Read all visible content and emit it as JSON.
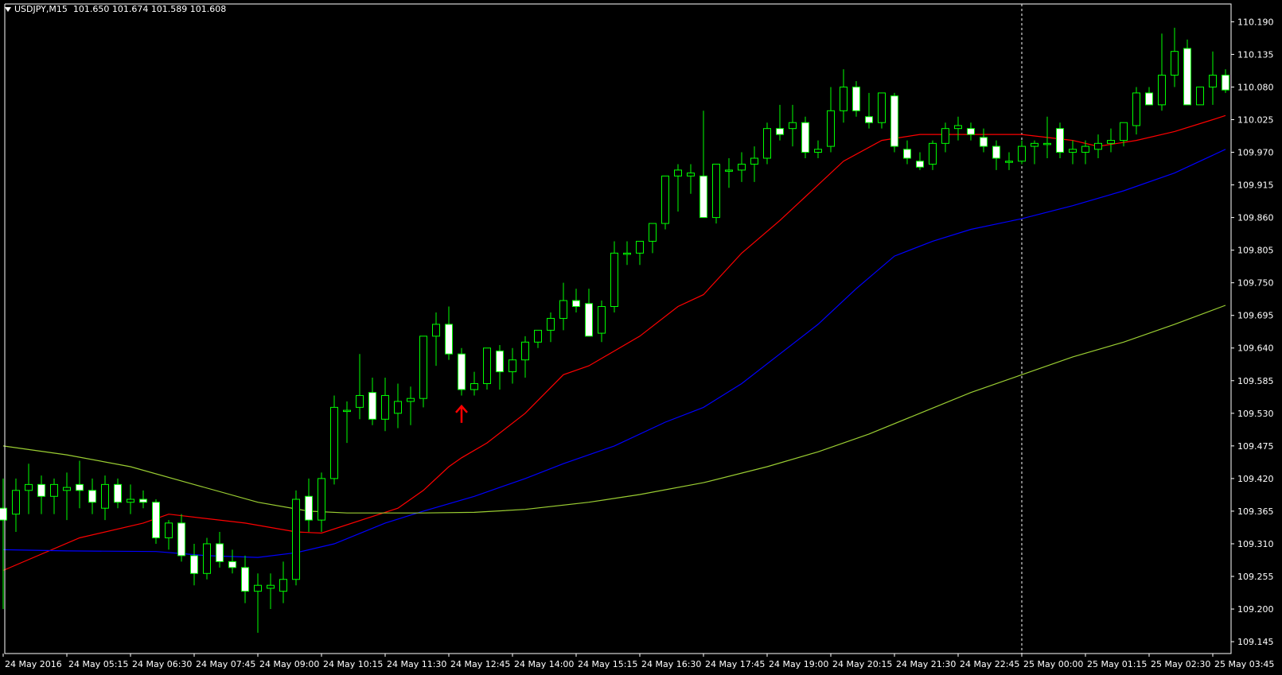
{
  "header": {
    "symbol": "USDJPY,M15",
    "ohlc": "101.650 101.674 101.589 101.608"
  },
  "colors": {
    "background": "#000000",
    "axis": "#ffffff",
    "bull_body": "#000000",
    "bear_body": "#ffffff",
    "wick": "#00ff00",
    "ma_fast": "#ff0000",
    "ma_mid": "#0000ff",
    "ma_slow": "#9acd32",
    "signal_arrow": "#ff0000",
    "period_separator": "#ffffff"
  },
  "icons": {
    "menu": "triangle-down-icon",
    "signal": "up-arrow-icon"
  },
  "chart_data": {
    "type": "candlestick",
    "title": "USDJPY,M15",
    "xlabel": "",
    "ylabel": "",
    "ylim": [
      109.125,
      110.22
    ],
    "grid": false,
    "legend": "none",
    "y_ticks": [
      "110.190",
      "110.135",
      "110.080",
      "110.025",
      "109.970",
      "109.915",
      "109.860",
      "109.805",
      "109.750",
      "109.695",
      "109.640",
      "109.585",
      "109.530",
      "109.475",
      "109.420",
      "109.365",
      "109.310",
      "109.255",
      "109.200",
      "109.145"
    ],
    "x_ticks": [
      "24 May 2016",
      "24 May 05:15",
      "24 May 06:30",
      "24 May 07:45",
      "24 May 09:00",
      "24 May 10:15",
      "24 May 11:30",
      "24 May 12:45",
      "24 May 14:00",
      "24 May 15:15",
      "24 May 16:30",
      "24 May 17:45",
      "24 May 19:00",
      "24 May 20:15",
      "24 May 21:30",
      "24 May 22:45",
      "25 May 00:00",
      "25 May 01:15",
      "25 May 02:30",
      "25 May 03:45"
    ],
    "x_tick_every": 5,
    "separator_bar": 80,
    "signal": {
      "type": "buy-arrow",
      "bar": 36,
      "price": 109.53
    },
    "candles": [
      [
        109.37,
        109.42,
        109.2,
        109.35
      ],
      [
        109.36,
        109.42,
        109.33,
        109.4
      ],
      [
        109.4,
        109.445,
        109.36,
        109.41
      ],
      [
        109.41,
        109.425,
        109.36,
        109.39
      ],
      [
        109.39,
        109.42,
        109.36,
        109.41
      ],
      [
        109.4,
        109.43,
        109.35,
        109.405
      ],
      [
        109.41,
        109.45,
        109.37,
        109.4
      ],
      [
        109.4,
        109.42,
        109.36,
        109.38
      ],
      [
        109.37,
        109.425,
        109.35,
        109.41
      ],
      [
        109.41,
        109.42,
        109.37,
        109.38
      ],
      [
        109.38,
        109.41,
        109.36,
        109.385
      ],
      [
        109.385,
        109.4,
        109.37,
        109.38
      ],
      [
        109.38,
        109.385,
        109.31,
        109.32
      ],
      [
        109.32,
        109.35,
        109.3,
        109.345
      ],
      [
        109.345,
        109.36,
        109.28,
        109.29
      ],
      [
        109.29,
        109.31,
        109.24,
        109.26
      ],
      [
        109.26,
        109.32,
        109.25,
        109.31
      ],
      [
        109.31,
        109.33,
        109.27,
        109.28
      ],
      [
        109.28,
        109.3,
        109.26,
        109.27
      ],
      [
        109.27,
        109.29,
        109.21,
        109.23
      ],
      [
        109.23,
        109.26,
        109.16,
        109.24
      ],
      [
        109.235,
        109.26,
        109.2,
        109.24
      ],
      [
        109.23,
        109.28,
        109.21,
        109.25
      ],
      [
        109.25,
        109.4,
        109.24,
        109.385
      ],
      [
        109.39,
        109.42,
        109.33,
        109.35
      ],
      [
        109.35,
        109.43,
        109.33,
        109.42
      ],
      [
        109.42,
        109.56,
        109.41,
        109.54
      ],
      [
        109.535,
        109.55,
        109.48,
        109.535
      ],
      [
        109.54,
        109.63,
        109.52,
        109.56
      ],
      [
        109.565,
        109.59,
        109.51,
        109.52
      ],
      [
        109.52,
        109.59,
        109.5,
        109.56
      ],
      [
        109.53,
        109.58,
        109.505,
        109.55
      ],
      [
        109.55,
        109.575,
        109.51,
        109.555
      ],
      [
        109.555,
        109.66,
        109.54,
        109.66
      ],
      [
        109.66,
        109.7,
        109.61,
        109.68
      ],
      [
        109.68,
        109.71,
        109.62,
        109.63
      ],
      [
        109.63,
        109.64,
        109.56,
        109.57
      ],
      [
        109.57,
        109.6,
        109.56,
        109.58
      ],
      [
        109.58,
        109.64,
        109.57,
        109.64
      ],
      [
        109.635,
        109.645,
        109.57,
        109.6
      ],
      [
        109.6,
        109.64,
        109.58,
        109.62
      ],
      [
        109.62,
        109.66,
        109.59,
        109.65
      ],
      [
        109.65,
        109.67,
        109.64,
        109.67
      ],
      [
        109.67,
        109.7,
        109.65,
        109.69
      ],
      [
        109.69,
        109.75,
        109.67,
        109.72
      ],
      [
        109.72,
        109.74,
        109.7,
        109.71
      ],
      [
        109.715,
        109.74,
        109.66,
        109.66
      ],
      [
        109.665,
        109.72,
        109.65,
        109.71
      ],
      [
        109.71,
        109.82,
        109.7,
        109.8
      ],
      [
        109.8,
        109.82,
        109.78,
        109.8
      ],
      [
        109.8,
        109.82,
        109.78,
        109.82
      ],
      [
        109.82,
        109.85,
        109.8,
        109.85
      ],
      [
        109.85,
        109.93,
        109.84,
        109.93
      ],
      [
        109.93,
        109.95,
        109.87,
        109.94
      ],
      [
        109.93,
        109.95,
        109.9,
        109.935
      ],
      [
        109.93,
        110.04,
        109.88,
        109.86
      ],
      [
        109.86,
        109.95,
        109.85,
        109.95
      ],
      [
        109.94,
        109.96,
        109.91,
        109.94
      ],
      [
        109.94,
        109.97,
        109.92,
        109.95
      ],
      [
        109.95,
        109.98,
        109.92,
        109.96
      ],
      [
        109.96,
        110.02,
        109.95,
        110.01
      ],
      [
        110.01,
        110.05,
        109.99,
        110.0
      ],
      [
        110.01,
        110.05,
        109.98,
        110.02
      ],
      [
        110.02,
        110.03,
        109.96,
        109.97
      ],
      [
        109.97,
        109.99,
        109.96,
        109.975
      ],
      [
        109.98,
        110.08,
        109.97,
        110.04
      ],
      [
        110.04,
        110.11,
        110.02,
        110.08
      ],
      [
        110.08,
        110.09,
        110.03,
        110.04
      ],
      [
        110.03,
        110.07,
        110.01,
        110.02
      ],
      [
        110.02,
        110.07,
        110.01,
        110.07
      ],
      [
        110.065,
        110.07,
        109.97,
        109.98
      ],
      [
        109.975,
        109.99,
        109.95,
        109.96
      ],
      [
        109.955,
        109.97,
        109.94,
        109.945
      ],
      [
        109.95,
        109.99,
        109.94,
        109.985
      ],
      [
        109.985,
        110.02,
        109.97,
        110.01
      ],
      [
        110.01,
        110.03,
        109.99,
        110.015
      ],
      [
        110.01,
        110.02,
        109.99,
        110.0
      ],
      [
        109.995,
        110.01,
        109.97,
        109.98
      ],
      [
        109.98,
        109.99,
        109.94,
        109.96
      ],
      [
        109.955,
        109.97,
        109.94,
        109.955
      ],
      [
        109.955,
        109.99,
        109.95,
        109.98
      ],
      [
        109.98,
        109.99,
        109.95,
        109.985
      ],
      [
        109.985,
        110.03,
        109.96,
        109.985
      ],
      [
        110.01,
        110.02,
        109.96,
        109.97
      ],
      [
        109.97,
        109.99,
        109.95,
        109.975
      ],
      [
        109.97,
        109.99,
        109.95,
        109.98
      ],
      [
        109.975,
        110.0,
        109.96,
        109.985
      ],
      [
        109.985,
        110.01,
        109.97,
        109.99
      ],
      [
        109.99,
        110.02,
        109.98,
        110.02
      ],
      [
        110.015,
        110.08,
        110.0,
        110.07
      ],
      [
        110.07,
        110.08,
        110.05,
        110.05
      ],
      [
        110.05,
        110.17,
        110.04,
        110.1
      ],
      [
        110.1,
        110.18,
        110.08,
        110.14
      ],
      [
        110.145,
        110.16,
        110.05,
        110.05
      ],
      [
        110.05,
        110.08,
        110.05,
        110.08
      ],
      [
        110.08,
        110.14,
        110.05,
        110.1
      ],
      [
        110.1,
        110.11,
        110.07,
        110.075
      ]
    ],
    "moving_averages": [
      {
        "color": "#ff0000",
        "points": [
          [
            0,
            109.265
          ],
          [
            6,
            109.32
          ],
          [
            11,
            109.345
          ],
          [
            13,
            109.36
          ],
          [
            19,
            109.345
          ],
          [
            23,
            109.33
          ],
          [
            25,
            109.328
          ],
          [
            31,
            109.37
          ],
          [
            33,
            109.4
          ],
          [
            35,
            109.44
          ],
          [
            36,
            109.455
          ],
          [
            38,
            109.48
          ],
          [
            41,
            109.53
          ],
          [
            44,
            109.595
          ],
          [
            46,
            109.61
          ],
          [
            50,
            109.66
          ],
          [
            53,
            109.71
          ],
          [
            55,
            109.73
          ],
          [
            58,
            109.8
          ],
          [
            61,
            109.855
          ],
          [
            63,
            109.895
          ],
          [
            66,
            109.955
          ],
          [
            69,
            109.99
          ],
          [
            72,
            110.0
          ],
          [
            75,
            110.0
          ],
          [
            80,
            110.0
          ],
          [
            84,
            109.99
          ],
          [
            86,
            109.98
          ],
          [
            89,
            109.99
          ],
          [
            92,
            110.005
          ],
          [
            95,
            110.025
          ],
          [
            96,
            110.032
          ]
        ]
      },
      {
        "color": "#0000ff",
        "points": [
          [
            0,
            109.3
          ],
          [
            5,
            109.298
          ],
          [
            12,
            109.297
          ],
          [
            16,
            109.29
          ],
          [
            20,
            109.287
          ],
          [
            23,
            109.295
          ],
          [
            26,
            109.31
          ],
          [
            30,
            109.345
          ],
          [
            33,
            109.365
          ],
          [
            37,
            109.39
          ],
          [
            41,
            109.42
          ],
          [
            44,
            109.445
          ],
          [
            48,
            109.475
          ],
          [
            52,
            109.515
          ],
          [
            55,
            109.54
          ],
          [
            58,
            109.58
          ],
          [
            61,
            109.63
          ],
          [
            64,
            109.68
          ],
          [
            67,
            109.74
          ],
          [
            70,
            109.795
          ],
          [
            73,
            109.82
          ],
          [
            76,
            109.84
          ],
          [
            80,
            109.858
          ],
          [
            84,
            109.88
          ],
          [
            88,
            109.905
          ],
          [
            92,
            109.935
          ],
          [
            96,
            109.975
          ]
        ]
      },
      {
        "color": "#9acd32",
        "points": [
          [
            0,
            109.475
          ],
          [
            5,
            109.46
          ],
          [
            10,
            109.44
          ],
          [
            15,
            109.41
          ],
          [
            20,
            109.38
          ],
          [
            24,
            109.365
          ],
          [
            27,
            109.362
          ],
          [
            33,
            109.362
          ],
          [
            37,
            109.363
          ],
          [
            41,
            109.368
          ],
          [
            46,
            109.38
          ],
          [
            50,
            109.393
          ],
          [
            55,
            109.413
          ],
          [
            60,
            109.44
          ],
          [
            64,
            109.465
          ],
          [
            68,
            109.495
          ],
          [
            72,
            109.53
          ],
          [
            76,
            109.565
          ],
          [
            80,
            109.595
          ],
          [
            84,
            109.625
          ],
          [
            88,
            109.65
          ],
          [
            92,
            109.68
          ],
          [
            96,
            109.712
          ]
        ]
      }
    ]
  }
}
